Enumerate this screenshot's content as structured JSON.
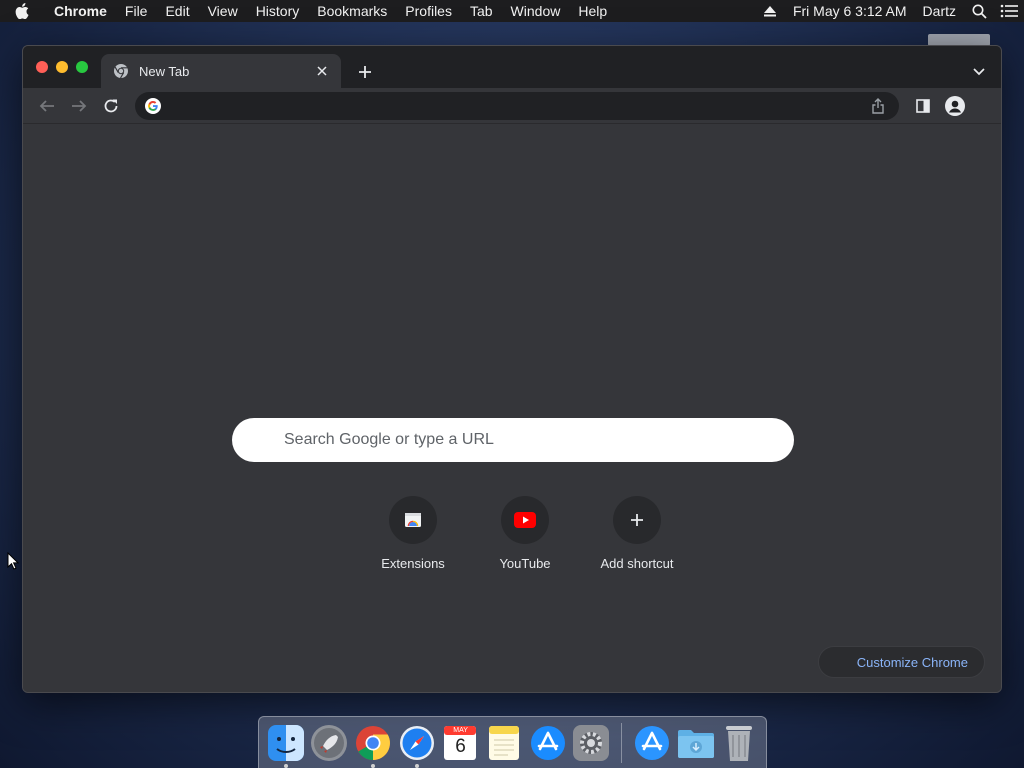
{
  "menubar": {
    "app_name": "Chrome",
    "items": [
      "File",
      "Edit",
      "View",
      "History",
      "Bookmarks",
      "Profiles",
      "Tab",
      "Window",
      "Help"
    ],
    "datetime": "Fri May 6  3:12 AM",
    "user": "Dartz"
  },
  "browser": {
    "tab": {
      "title": "New Tab"
    },
    "omnibox": {
      "value": ""
    },
    "search": {
      "placeholder": "Search Google or type a URL"
    },
    "shortcuts": [
      {
        "label": "Extensions",
        "icon": "extensions-icon"
      },
      {
        "label": "YouTube",
        "icon": "youtube-icon"
      },
      {
        "label": "Add shortcut",
        "icon": "plus-icon"
      }
    ],
    "customize_label": "Customize Chrome"
  },
  "dock": {
    "calendar": {
      "month": "MAY",
      "day": "6"
    },
    "apps": [
      "Finder",
      "Launchpad",
      "Google Chrome",
      "Safari",
      "Calendar",
      "Notes",
      "App Store",
      "System Preferences",
      "App Store (2)",
      "Downloads",
      "Trash"
    ]
  },
  "colors": {
    "window_bg": "#35363a",
    "tabstrip_bg": "#202124",
    "link_blue": "#8ab4f8"
  }
}
